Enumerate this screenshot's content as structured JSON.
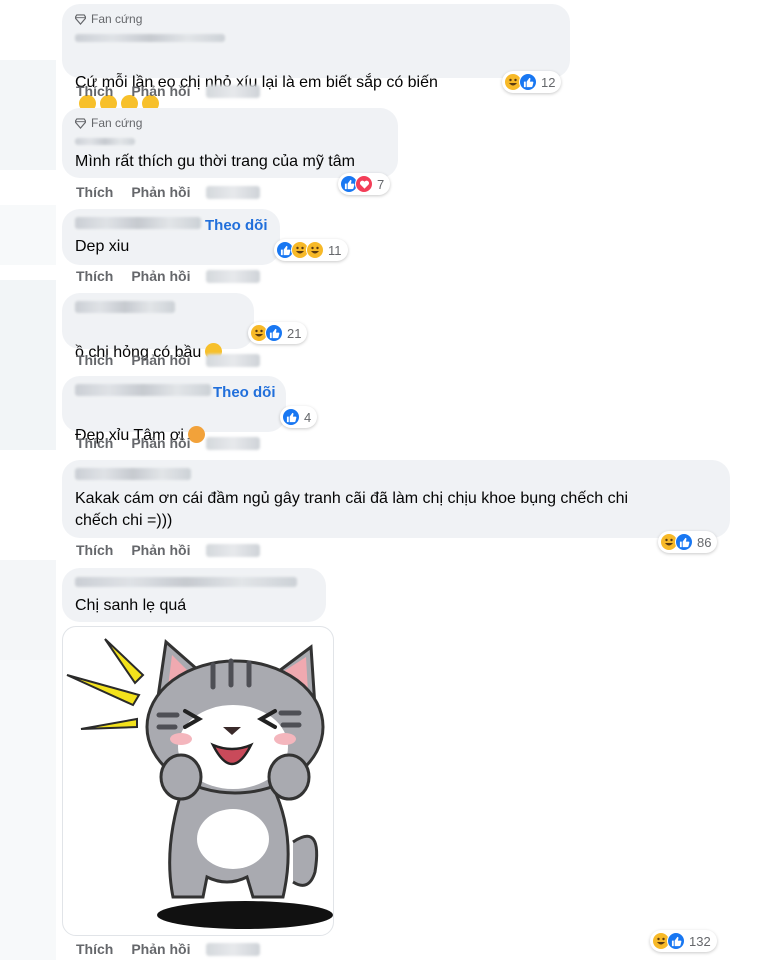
{
  "comments": [
    {
      "badge": "Fan cứng",
      "text": "Cứ mỗi lần eo chị nhỏ xíu lại là em biết sắp có biến",
      "reaction_count": "12",
      "like": "Thích",
      "reply": "Phản hồi"
    },
    {
      "badge": "Fan cứng",
      "text": "Mình rất thích gu thời trang của mỹ tâm",
      "reaction_count": "7",
      "like": "Thích",
      "reply": "Phản hồi"
    },
    {
      "follow": "Theo dõi",
      "text": "Dep xiu",
      "reaction_count": "11",
      "like": "Thích",
      "reply": "Phản hồi"
    },
    {
      "text": "ồ chị hỏng có bầu",
      "reaction_count": "21",
      "like": "Thích",
      "reply": "Phản hồi"
    },
    {
      "follow": "Theo dõi",
      "text": "Đẹp xỉu Tâm ơi",
      "reaction_count": "4",
      "like": "Thích",
      "reply": "Phản hồi"
    },
    {
      "text": "Kakak cám ơn cái đầm ngủ gây tranh cãi đã làm chị chịu khoe bụng chếch chi\nchếch chi =)))",
      "reaction_count": "86",
      "like": "Thích",
      "reply": "Phản hồi"
    },
    {
      "text": "Chị sanh lẹ quá",
      "reaction_count": "132",
      "like": "Thích",
      "reply": "Phản hồi"
    }
  ],
  "colors": {
    "accent": "#216fdb",
    "bubble": "#f0f2f5",
    "like_blue": "#1877f2",
    "haha_yellow": "#f7b928",
    "love_red": "#f33e58"
  },
  "icons": [
    "gem-icon",
    "like-icon",
    "haha-icon",
    "love-icon",
    "wow-icon",
    "care-icon",
    "grinning-emoji",
    "heart-eyes-emoji"
  ]
}
